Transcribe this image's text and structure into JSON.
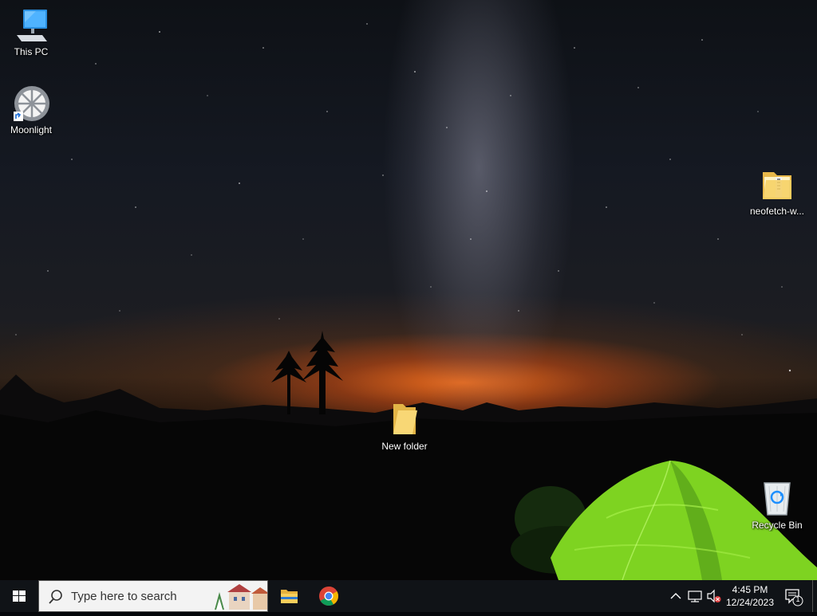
{
  "desktop": {
    "icons": [
      {
        "label": "This PC"
      },
      {
        "label": "Moonlight"
      },
      {
        "label": "neofetch-w..."
      },
      {
        "label": "New folder"
      },
      {
        "label": "Recycle Bin"
      }
    ]
  },
  "taskbar": {
    "start_icon": "windows-logo-icon",
    "search": {
      "placeholder": "Type here to search",
      "icon": "search-icon"
    },
    "pinned_apps": [
      {
        "name": "File Explorer",
        "icon": "folder-icon"
      },
      {
        "name": "Google Chrome",
        "icon": "chrome-icon"
      }
    ],
    "tray": {
      "icons": [
        "chevron-up-icon",
        "network-icon",
        "volume-muted-icon"
      ],
      "time": "4:45 PM",
      "date": "12/24/2023",
      "notification_count": "1"
    }
  },
  "colors": {
    "taskbar_bg": "#101317",
    "search_bg": "#f3f3f3",
    "accent_blue": "#1e90ff",
    "tent_green": "#7ed321"
  }
}
